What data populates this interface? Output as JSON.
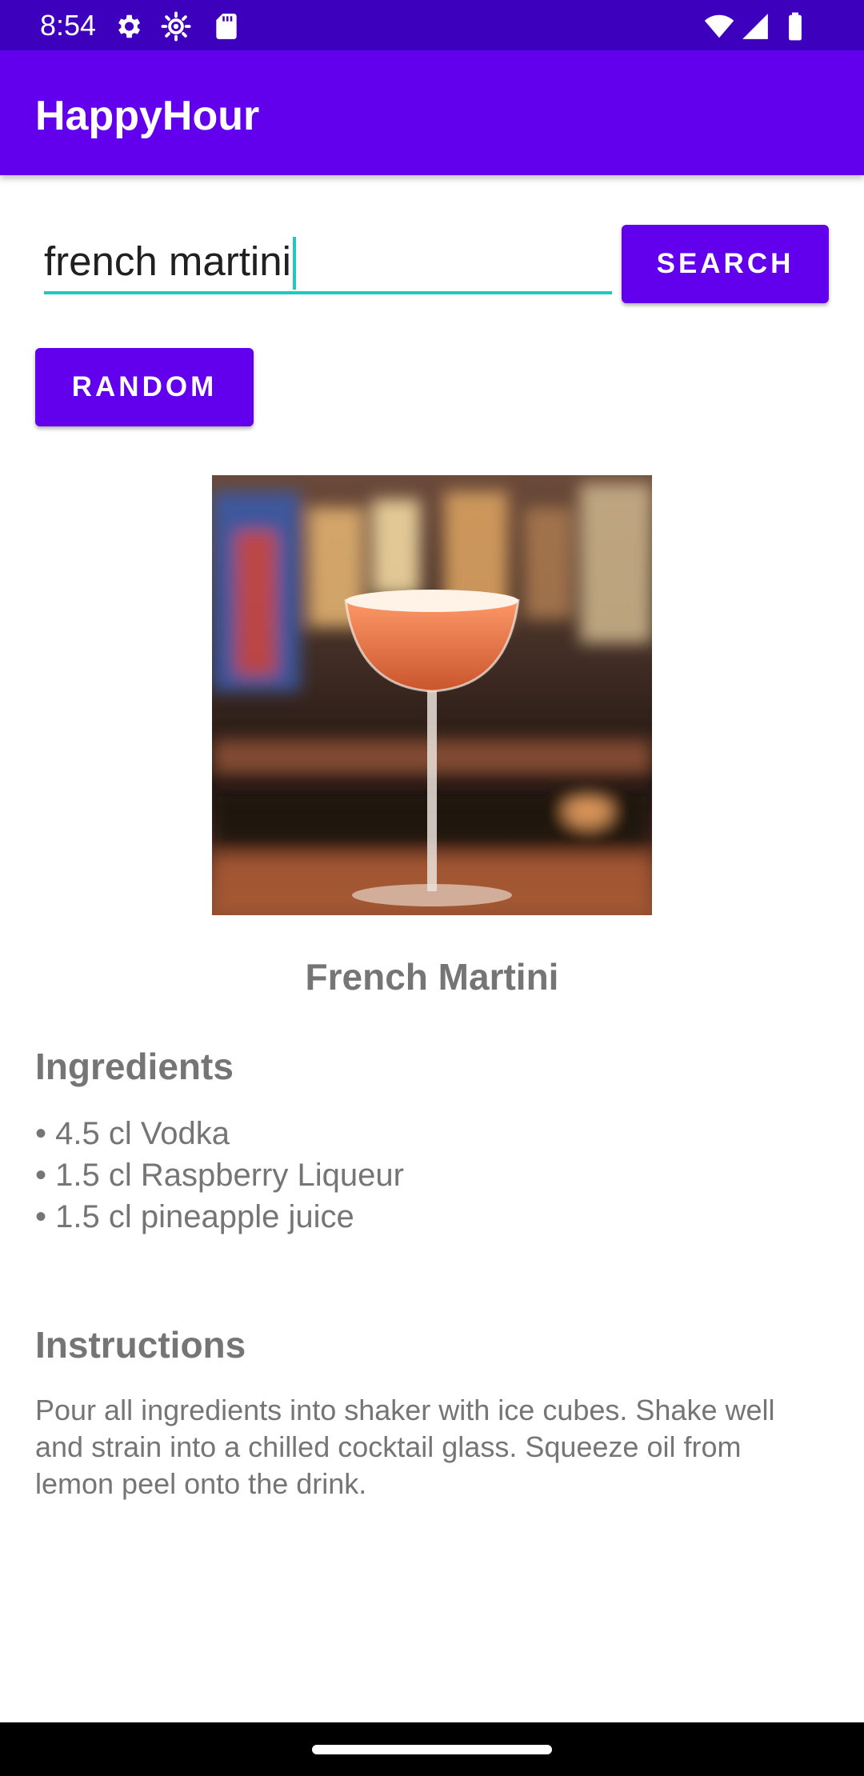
{
  "status_bar": {
    "time": "8:54",
    "icons": [
      "settings-gear-icon",
      "sun-brightness-icon",
      "sd-card-icon",
      "wifi-icon",
      "signal-icon",
      "battery-icon"
    ]
  },
  "app_bar": {
    "title": "HappyHour"
  },
  "search": {
    "value": "french martini",
    "button_label": "SEARCH"
  },
  "random_button": {
    "label": "RANDOM"
  },
  "drink": {
    "name": "French Martini",
    "image_icon": "cocktail-photo",
    "ingredients_heading": "Ingredients",
    "ingredients": [
      "• 4.5 cl Vodka",
      "• 1.5 cl Raspberry Liqueur",
      "• 1.5 cl pineapple juice"
    ],
    "instructions_heading": "Instructions",
    "instructions": "Pour all ingredients into shaker with ice cubes. Shake well and strain into a chilled cocktail glass. Squeeze oil from lemon peel onto the drink."
  },
  "colors": {
    "primary": "#6200ee",
    "primary_dark": "#3d00bd",
    "accent": "#1ec9bd",
    "text_secondary": "#757575"
  }
}
